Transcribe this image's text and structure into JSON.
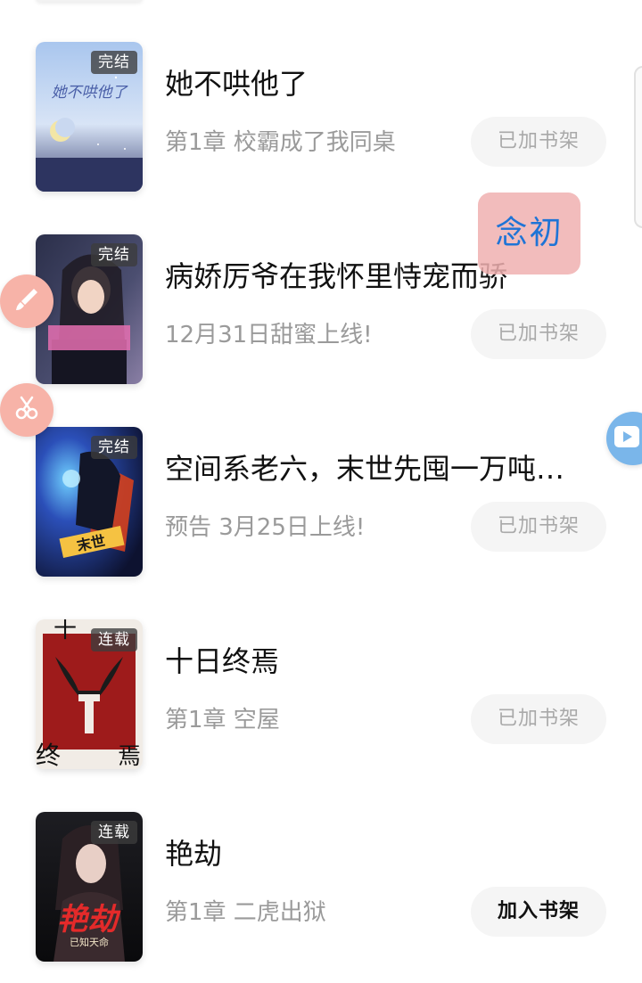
{
  "books": [
    {
      "tag": "完结",
      "title": "她不哄他了",
      "subtitle": "第1章 校霸成了我同桌",
      "button": "已加书架",
      "cover_text": "她不哄他了"
    },
    {
      "tag": "完结",
      "title": "病娇厉爷在我怀里恃宠而骄",
      "subtitle": "12月31日甜蜜上线!",
      "button": "已加书架"
    },
    {
      "tag": "完结",
      "title": "空间系老六，末世先囤一万吨猪…",
      "subtitle": "预告 3月25日上线!",
      "button": "已加书架",
      "cover_text": "末世"
    },
    {
      "tag": "连载",
      "title": "十日终焉",
      "subtitle": "第1章 空屋",
      "button": "已加书架",
      "cover_text_top": "十",
      "cover_text_bottom_left": "终",
      "cover_text_bottom_right": "焉"
    },
    {
      "tag": "连载",
      "title": "艳劫",
      "subtitle": "第1章 二虎出狱",
      "button": "加入书架",
      "cover_text": "艳劫",
      "cover_subtext": "已知天命"
    }
  ],
  "floating": {
    "name_tag": "念初",
    "brush_icon": "brush-icon",
    "scissors_icon": "scissors-icon",
    "play_icon": "play-icon"
  },
  "colors": {
    "button_bg": "#f5f5f5",
    "button_added_text": "#a9a9a9",
    "button_add_text": "#111111",
    "subtitle_text": "#9a9a9a",
    "tag_bg": "#3c3c3c"
  }
}
